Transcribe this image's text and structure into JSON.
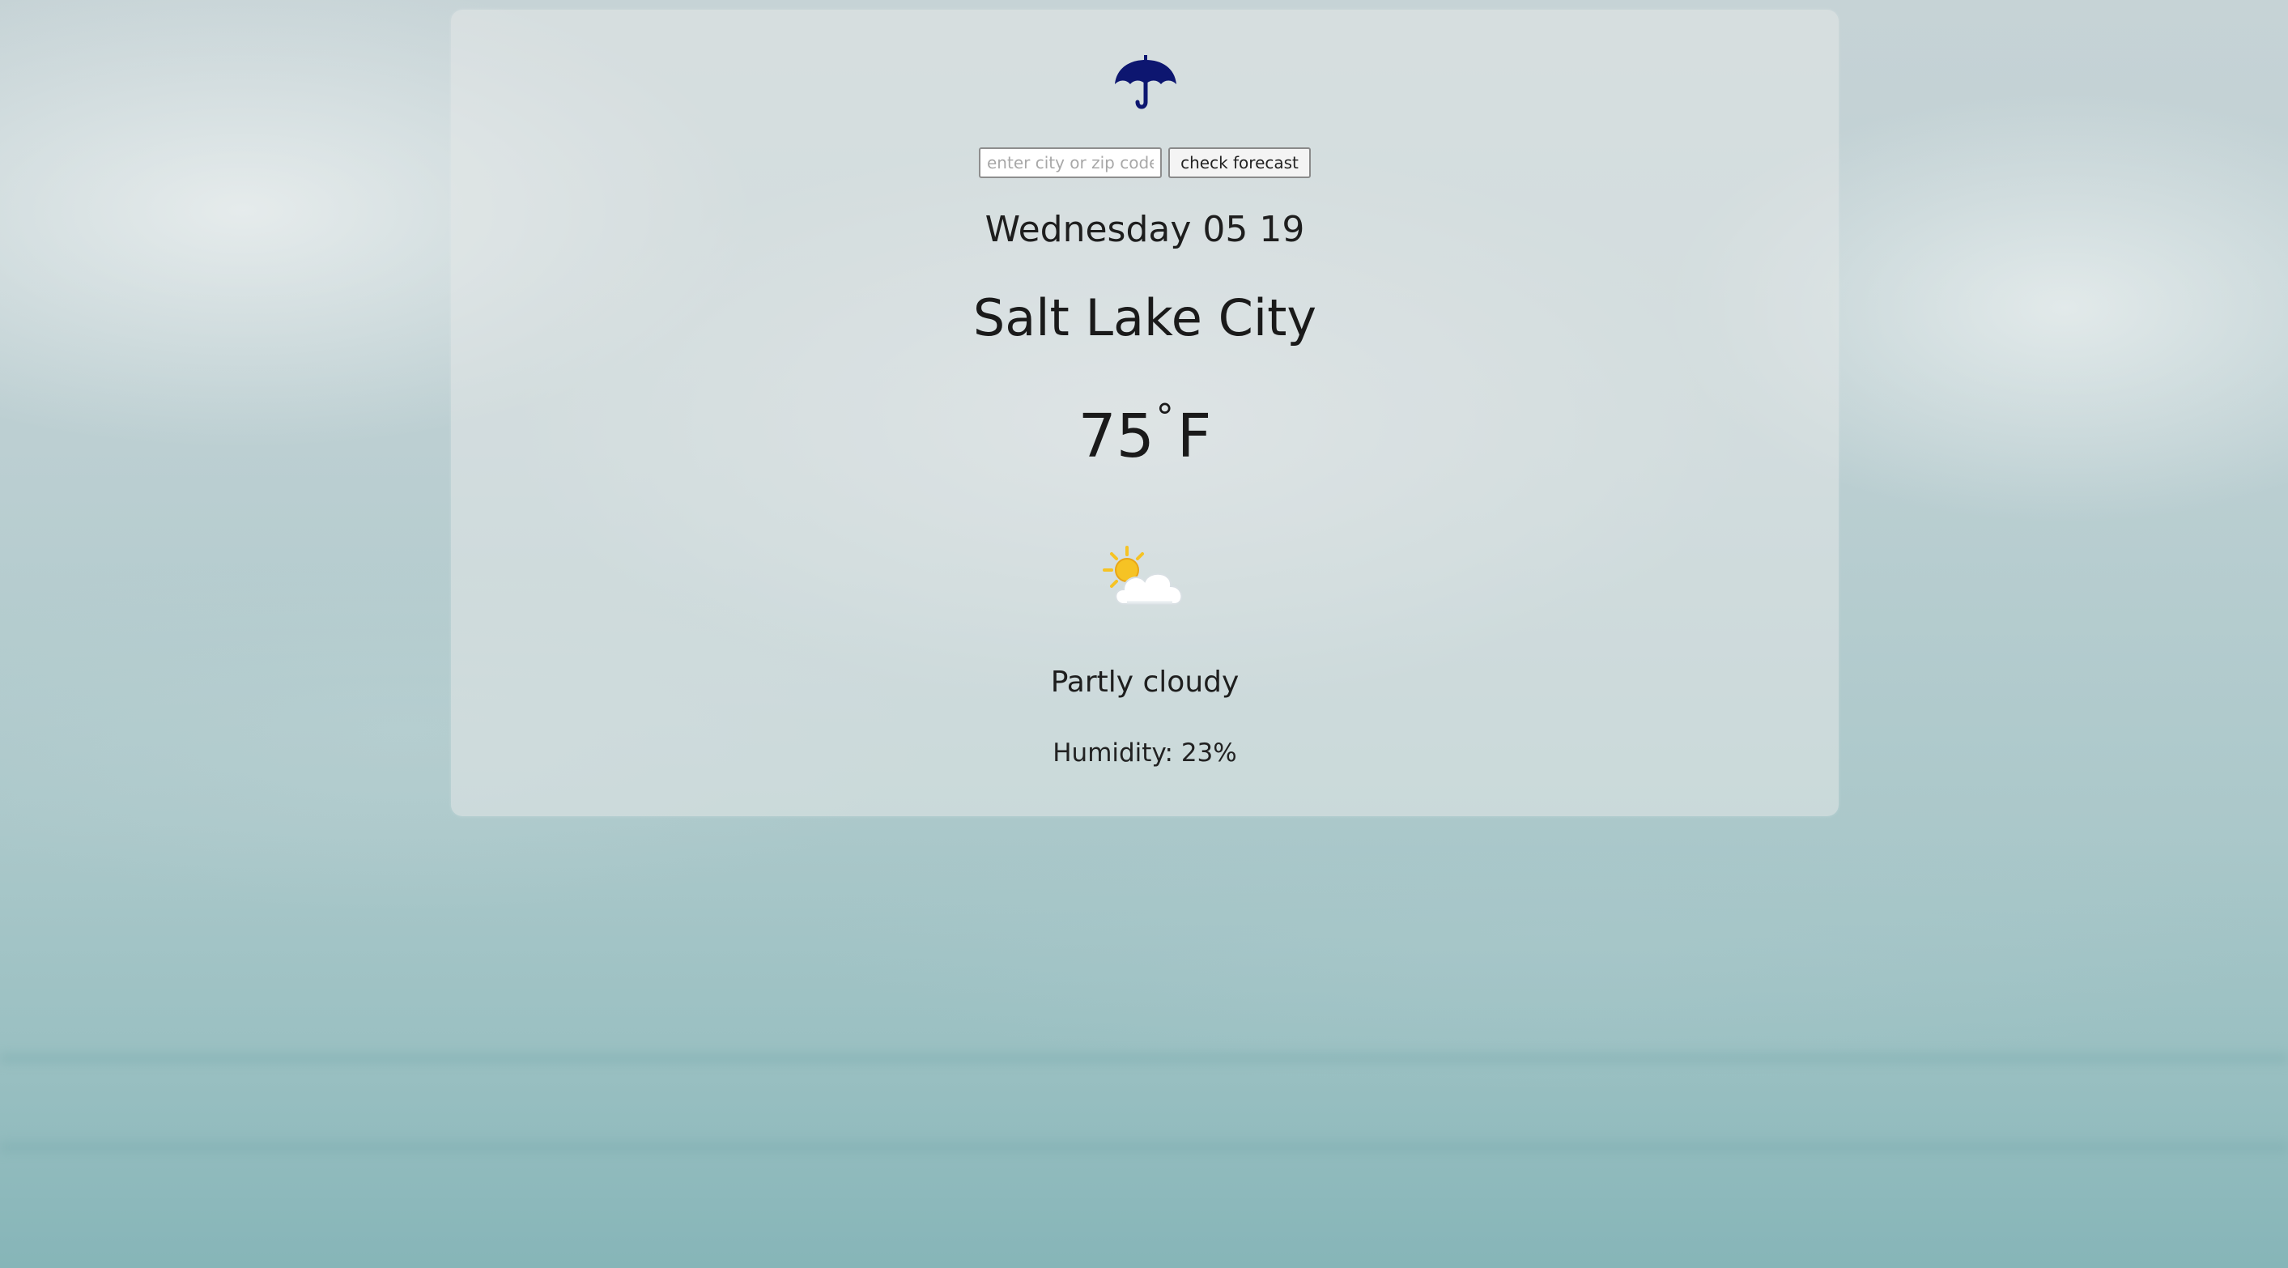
{
  "search": {
    "placeholder": "enter city or zip code",
    "value": "",
    "button_label": "check forecast"
  },
  "weather": {
    "date": "Wednesday 05 19",
    "city": "Salt Lake City",
    "temperature": "75",
    "degree_symbol": "°",
    "unit": "F",
    "description": "Partly cloudy",
    "humidity": "Humidity: 23%",
    "icon": "partly-cloudy-icon"
  },
  "icons": {
    "logo": "umbrella-icon"
  },
  "colors": {
    "logo": "#0d1670",
    "sun": "#f6c324",
    "cloud": "#ffffff"
  }
}
